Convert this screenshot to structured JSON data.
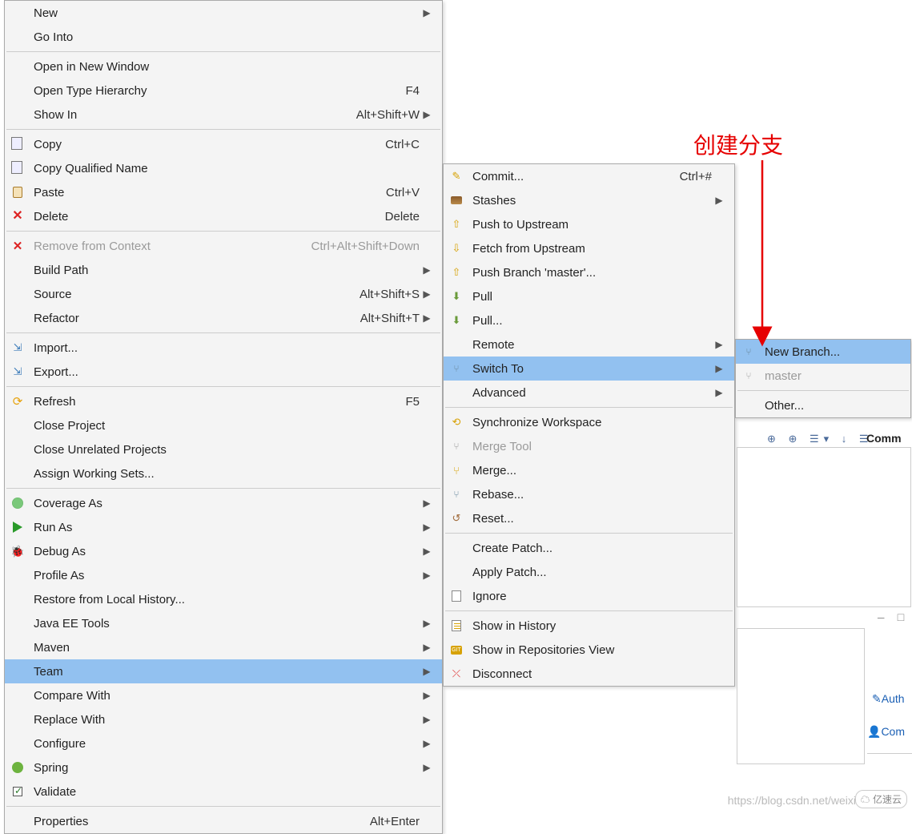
{
  "annotation": {
    "text": "创建分支"
  },
  "menus": {
    "main": [
      {
        "id": "new",
        "label": "New",
        "submenu": true
      },
      {
        "id": "go-into",
        "label": "Go Into"
      },
      {
        "sep": true
      },
      {
        "id": "open-new-window",
        "label": "Open in New Window"
      },
      {
        "id": "open-type-hierarchy",
        "label": "Open Type Hierarchy",
        "shortcut": "F4"
      },
      {
        "id": "show-in",
        "label": "Show In",
        "shortcut": "Alt+Shift+W",
        "submenu": true
      },
      {
        "sep": true
      },
      {
        "id": "copy",
        "label": "Copy",
        "shortcut": "Ctrl+C",
        "icon": "copy"
      },
      {
        "id": "copy-qualified",
        "label": "Copy Qualified Name",
        "icon": "copy"
      },
      {
        "id": "paste",
        "label": "Paste",
        "shortcut": "Ctrl+V",
        "icon": "paste"
      },
      {
        "id": "delete",
        "label": "Delete",
        "shortcut": "Delete",
        "icon": "delete"
      },
      {
        "sep": true
      },
      {
        "id": "remove-context",
        "label": "Remove from Context",
        "shortcut": "Ctrl+Alt+Shift+Down",
        "icon": "cross",
        "disabled": true
      },
      {
        "id": "build-path",
        "label": "Build Path",
        "submenu": true
      },
      {
        "id": "source",
        "label": "Source",
        "shortcut": "Alt+Shift+S",
        "submenu": true
      },
      {
        "id": "refactor",
        "label": "Refactor",
        "shortcut": "Alt+Shift+T",
        "submenu": true
      },
      {
        "sep": true
      },
      {
        "id": "import",
        "label": "Import...",
        "icon": "import"
      },
      {
        "id": "export",
        "label": "Export...",
        "icon": "import"
      },
      {
        "sep": true
      },
      {
        "id": "refresh",
        "label": "Refresh",
        "shortcut": "F5",
        "icon": "refresh"
      },
      {
        "id": "close-project",
        "label": "Close Project"
      },
      {
        "id": "close-unrelated",
        "label": "Close Unrelated Projects"
      },
      {
        "id": "assign-ws",
        "label": "Assign Working Sets..."
      },
      {
        "sep": true
      },
      {
        "id": "coverage-as",
        "label": "Coverage As",
        "submenu": true,
        "icon": "coverage"
      },
      {
        "id": "run-as",
        "label": "Run As",
        "submenu": true,
        "icon": "run"
      },
      {
        "id": "debug-as",
        "label": "Debug As",
        "submenu": true,
        "icon": "debug"
      },
      {
        "id": "profile-as",
        "label": "Profile As",
        "submenu": true
      },
      {
        "id": "restore-local",
        "label": "Restore from Local History..."
      },
      {
        "id": "javaee-tools",
        "label": "Java EE Tools",
        "submenu": true
      },
      {
        "id": "maven",
        "label": "Maven",
        "submenu": true
      },
      {
        "id": "team",
        "label": "Team",
        "submenu": true,
        "highlighted": true
      },
      {
        "id": "compare-with",
        "label": "Compare With",
        "submenu": true
      },
      {
        "id": "replace-with",
        "label": "Replace With",
        "submenu": true
      },
      {
        "id": "configure",
        "label": "Configure",
        "submenu": true
      },
      {
        "id": "spring",
        "label": "Spring",
        "submenu": true,
        "icon": "spring"
      },
      {
        "id": "validate",
        "label": "Validate",
        "icon": "validate"
      },
      {
        "sep": true
      },
      {
        "id": "properties",
        "label": "Properties",
        "shortcut": "Alt+Enter"
      }
    ],
    "team": [
      {
        "id": "commit",
        "label": "Commit...",
        "shortcut": "Ctrl+#",
        "icon": "commit"
      },
      {
        "id": "stashes",
        "label": "Stashes",
        "submenu": true,
        "icon": "stash"
      },
      {
        "id": "push-upstream",
        "label": "Push to Upstream",
        "icon": "push"
      },
      {
        "id": "fetch-upstream",
        "label": "Fetch from Upstream",
        "icon": "fetch"
      },
      {
        "id": "push-branch",
        "label": "Push Branch 'master'...",
        "icon": "push"
      },
      {
        "id": "pull",
        "label": "Pull",
        "icon": "pull"
      },
      {
        "id": "pull-dots",
        "label": "Pull...",
        "icon": "pull"
      },
      {
        "id": "remote",
        "label": "Remote",
        "submenu": true
      },
      {
        "id": "switch-to",
        "label": "Switch To",
        "submenu": true,
        "icon": "branch",
        "highlighted": true
      },
      {
        "id": "advanced",
        "label": "Advanced",
        "submenu": true
      },
      {
        "sep": true
      },
      {
        "id": "sync-ws",
        "label": "Synchronize Workspace",
        "icon": "sync"
      },
      {
        "id": "merge-tool",
        "label": "Merge Tool",
        "icon": "mergetool",
        "disabled": true
      },
      {
        "id": "merge",
        "label": "Merge...",
        "icon": "merge"
      },
      {
        "id": "rebase",
        "label": "Rebase...",
        "icon": "branch"
      },
      {
        "id": "reset",
        "label": "Reset...",
        "icon": "reset"
      },
      {
        "sep": true
      },
      {
        "id": "create-patch",
        "label": "Create Patch..."
      },
      {
        "id": "apply-patch",
        "label": "Apply Patch..."
      },
      {
        "id": "ignore",
        "label": "Ignore",
        "icon": "ignore"
      },
      {
        "sep": true
      },
      {
        "id": "show-history",
        "label": "Show in History",
        "icon": "hist"
      },
      {
        "id": "show-repo-view",
        "label": "Show in Repositories View",
        "icon": "git"
      },
      {
        "id": "disconnect",
        "label": "Disconnect",
        "icon": "disconnect"
      }
    ],
    "switch": [
      {
        "id": "new-branch",
        "label": "New Branch...",
        "icon": "newbranch",
        "highlighted": true
      },
      {
        "id": "master",
        "label": "master",
        "icon": "master",
        "disabled": true
      },
      {
        "sep": true
      },
      {
        "id": "other",
        "label": "Other..."
      }
    ]
  },
  "ide": {
    "commentLabel": "Comm",
    "authorLabel": "Auth",
    "commitLabel": "Com",
    "watermark": "https://blog.csdn.net/weixi",
    "logo": "亿速云"
  }
}
